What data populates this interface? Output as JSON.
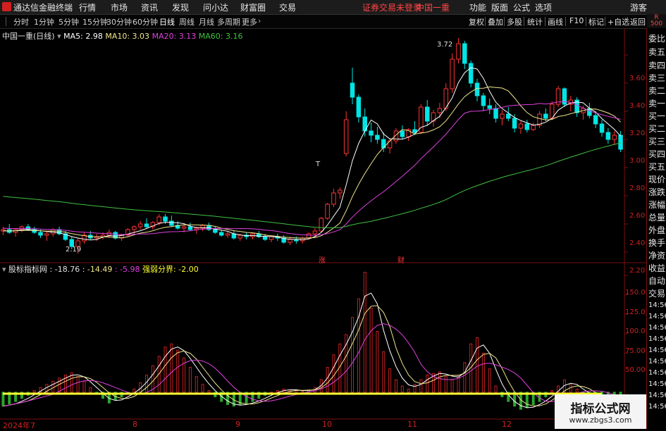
{
  "menubar": {
    "app_title": "通达信金融终端",
    "menus": [
      "行情",
      "市场",
      "资讯",
      "发现",
      "问小达",
      "财富圈",
      "交易"
    ],
    "notice": "证券交易未登录",
    "stock": "中国一重",
    "right_menus": [
      "功能",
      "版面",
      "公式",
      "选项"
    ],
    "user": "游客"
  },
  "periods": [
    "分时",
    "1分钟",
    "5分钟",
    "15分钟",
    "30分钟",
    "60分钟",
    "日线",
    "周线",
    "月线",
    "多周期",
    "更多"
  ],
  "active_period": "日线",
  "toolbar": [
    "复权",
    "叠加",
    "多股",
    "统计",
    "画线",
    "F10",
    "标记",
    "+自选",
    "返回"
  ],
  "corner_badge": {
    "top": "R",
    "bottom": "500"
  },
  "main_legend": {
    "title": "中国一重(日线)",
    "ma5": "MA5: 2.98",
    "ma10": "MA10: 3.03",
    "ma20": "MA20: 3.13",
    "ma60": "MA60: 3.16"
  },
  "sub_legend": {
    "name": "股标指标网",
    "v1": ": -18.76",
    "v2": ": -14.49",
    "v3": ": -5.98",
    "v4": "强弱分界: -2.00"
  },
  "price_axis": [
    "3.60",
    "3.40",
    "3.20",
    "3.00",
    "2.80",
    "2.60",
    "2.40",
    "2.20"
  ],
  "sub_axis": [
    "150.0",
    "125.0",
    "100.0",
    "75.00",
    "50.00"
  ],
  "annotations": {
    "high": "3.72",
    "low": "2.19",
    "t_mark": "T",
    "zhang": "涨",
    "cai": "财"
  },
  "dates": [
    "2024年7",
    "8",
    "9",
    "10",
    "11",
    "12"
  ],
  "side_panel": [
    "委比",
    "卖五",
    "卖四",
    "卖三",
    "卖二",
    "卖一",
    "买一",
    "买二",
    "买三",
    "买四",
    "买五",
    "现价",
    "涨跌",
    "涨幅",
    "总量",
    "外盘",
    "换手",
    "净资",
    "收益",
    "自动",
    "交易",
    "14:56",
    "14:56",
    "14:56",
    "14:56",
    "14:56",
    "14:56",
    "14:56",
    "14:56",
    "14:56",
    "14:56"
  ],
  "watermark": {
    "title": "指标公式网",
    "url": "www.zbgs3.com"
  },
  "colors": {
    "up": "#ff3333",
    "down": "#00e5e5",
    "ma5": "#ffffff",
    "ma10": "#f0e68c",
    "ma20": "#e040e0",
    "ma60": "#40c040",
    "yellow_line": "#ffff33"
  },
  "chart_data": {
    "type": "candlestick",
    "ylim": [
      2.13,
      3.78
    ],
    "candles": [
      [
        2.35,
        2.38,
        2.32,
        2.36
      ],
      [
        2.36,
        2.4,
        2.33,
        2.34
      ],
      [
        2.34,
        2.37,
        2.31,
        2.36
      ],
      [
        2.36,
        2.39,
        2.34,
        2.38
      ],
      [
        2.38,
        2.4,
        2.35,
        2.36
      ],
      [
        2.36,
        2.38,
        2.33,
        2.34
      ],
      [
        2.34,
        2.36,
        2.3,
        2.32
      ],
      [
        2.32,
        2.35,
        2.28,
        2.33
      ],
      [
        2.33,
        2.37,
        2.31,
        2.36
      ],
      [
        2.36,
        2.38,
        2.32,
        2.33
      ],
      [
        2.33,
        2.35,
        2.28,
        2.29
      ],
      [
        2.29,
        2.31,
        2.22,
        2.24
      ],
      [
        2.24,
        2.3,
        2.19,
        2.28
      ],
      [
        2.28,
        2.34,
        2.26,
        2.32
      ],
      [
        2.32,
        2.35,
        2.29,
        2.3
      ],
      [
        2.3,
        2.33,
        2.28,
        2.31
      ],
      [
        2.31,
        2.34,
        2.29,
        2.32
      ],
      [
        2.32,
        2.36,
        2.3,
        2.34
      ],
      [
        2.34,
        2.35,
        2.29,
        2.3
      ],
      [
        2.3,
        2.33,
        2.28,
        2.32
      ],
      [
        2.32,
        2.37,
        2.31,
        2.36
      ],
      [
        2.36,
        2.39,
        2.33,
        2.38
      ],
      [
        2.38,
        2.42,
        2.36,
        2.4
      ],
      [
        2.4,
        2.44,
        2.37,
        2.38
      ],
      [
        2.38,
        2.42,
        2.36,
        2.41
      ],
      [
        2.41,
        2.47,
        2.39,
        2.45
      ],
      [
        2.45,
        2.47,
        2.4,
        2.42
      ],
      [
        2.42,
        2.46,
        2.38,
        2.39
      ],
      [
        2.39,
        2.42,
        2.36,
        2.37
      ],
      [
        2.37,
        2.4,
        2.34,
        2.38
      ],
      [
        2.38,
        2.41,
        2.35,
        2.36
      ],
      [
        2.36,
        2.38,
        2.33,
        2.37
      ],
      [
        2.37,
        2.4,
        2.35,
        2.39
      ],
      [
        2.39,
        2.41,
        2.35,
        2.36
      ],
      [
        2.36,
        2.38,
        2.33,
        2.34
      ],
      [
        2.34,
        2.36,
        2.31,
        2.32
      ],
      [
        2.32,
        2.35,
        2.3,
        2.33
      ],
      [
        2.33,
        2.35,
        2.29,
        2.3
      ],
      [
        2.3,
        2.33,
        2.28,
        2.32
      ],
      [
        2.32,
        2.34,
        2.29,
        2.31
      ],
      [
        2.31,
        2.34,
        2.29,
        2.33
      ],
      [
        2.33,
        2.35,
        2.3,
        2.31
      ],
      [
        2.31,
        2.33,
        2.28,
        2.29
      ],
      [
        2.29,
        2.32,
        2.27,
        2.31
      ],
      [
        2.31,
        2.33,
        2.28,
        2.3
      ],
      [
        2.3,
        2.32,
        2.26,
        2.27
      ],
      [
        2.27,
        2.31,
        2.25,
        2.29
      ],
      [
        2.29,
        2.31,
        2.26,
        2.28
      ],
      [
        2.28,
        2.31,
        2.26,
        2.3
      ],
      [
        2.3,
        2.34,
        2.29,
        2.33
      ],
      [
        2.33,
        2.37,
        2.31,
        2.35
      ],
      [
        2.35,
        2.45,
        2.34,
        2.44
      ],
      [
        2.44,
        2.55,
        2.43,
        2.54
      ],
      [
        2.54,
        2.65,
        2.52,
        2.62
      ],
      [
        2.62,
        2.66,
        2.58,
        2.64
      ],
      [
        2.9,
        3.2,
        2.88,
        3.14
      ],
      [
        3.4,
        3.51,
        3.25,
        3.3
      ],
      [
        3.3,
        3.32,
        3.12,
        3.16
      ],
      [
        3.16,
        3.22,
        3.02,
        3.06
      ],
      [
        3.06,
        3.12,
        2.98,
        3.03
      ],
      [
        3.03,
        3.09,
        2.97,
        3.0
      ],
      [
        3.0,
        3.05,
        2.91,
        2.94
      ],
      [
        2.94,
        3.01,
        2.9,
        2.99
      ],
      [
        2.99,
        3.08,
        2.97,
        3.06
      ],
      [
        3.06,
        3.1,
        3.0,
        3.02
      ],
      [
        3.02,
        3.08,
        2.99,
        3.07
      ],
      [
        3.07,
        3.13,
        3.03,
        3.05
      ],
      [
        3.05,
        3.25,
        3.04,
        3.23
      ],
      [
        3.23,
        3.28,
        3.1,
        3.13
      ],
      [
        3.13,
        3.21,
        3.09,
        3.19
      ],
      [
        3.19,
        3.26,
        3.15,
        3.22
      ],
      [
        3.22,
        3.4,
        3.2,
        3.36
      ],
      [
        3.36,
        3.61,
        3.33,
        3.57
      ],
      [
        3.57,
        3.72,
        3.54,
        3.68
      ],
      [
        3.68,
        3.7,
        3.5,
        3.54
      ],
      [
        3.54,
        3.56,
        3.37,
        3.4
      ],
      [
        3.4,
        3.43,
        3.27,
        3.31
      ],
      [
        3.31,
        3.33,
        3.2,
        3.24
      ],
      [
        3.24,
        3.29,
        3.18,
        3.22
      ],
      [
        3.22,
        3.25,
        3.12,
        3.15
      ],
      [
        3.15,
        3.21,
        3.1,
        3.18
      ],
      [
        3.18,
        3.23,
        3.13,
        3.15
      ],
      [
        3.15,
        3.18,
        3.05,
        3.08
      ],
      [
        3.08,
        3.13,
        3.04,
        3.11
      ],
      [
        3.11,
        3.14,
        3.05,
        3.07
      ],
      [
        3.07,
        3.12,
        3.06,
        3.1
      ],
      [
        3.1,
        3.2,
        3.08,
        3.18
      ],
      [
        3.18,
        3.22,
        3.13,
        3.15
      ],
      [
        3.15,
        3.27,
        3.14,
        3.25
      ],
      [
        3.25,
        3.38,
        3.23,
        3.36
      ],
      [
        3.36,
        3.37,
        3.23,
        3.25
      ],
      [
        3.25,
        3.31,
        3.2,
        3.28
      ],
      [
        3.28,
        3.3,
        3.16,
        3.19
      ],
      [
        3.19,
        3.24,
        3.14,
        3.22
      ],
      [
        3.22,
        3.26,
        3.15,
        3.17
      ],
      [
        3.17,
        3.2,
        3.08,
        3.11
      ],
      [
        3.11,
        3.14,
        3.02,
        3.05
      ],
      [
        3.05,
        3.08,
        2.97,
        3.0
      ],
      [
        3.0,
        3.06,
        2.96,
        3.03
      ],
      [
        3.03,
        3.06,
        2.91,
        2.93
      ]
    ],
    "sub_indicator": {
      "name": "股标指标网",
      "ylim": [
        -30,
        160
      ],
      "threshold": -2,
      "bars": [
        -18,
        -15,
        -12,
        -8,
        -4,
        2,
        6,
        10,
        14,
        18,
        22,
        25,
        20,
        14,
        6,
        -2,
        -8,
        -14,
        -10,
        -6,
        -2,
        4,
        12,
        22,
        34,
        46,
        58,
        62,
        54,
        44,
        32,
        20,
        10,
        2,
        -6,
        -12,
        -16,
        -18,
        -16,
        -14,
        -12,
        -8,
        -4,
        0,
        2,
        4,
        3,
        2,
        1,
        3,
        6,
        16,
        32,
        48,
        62,
        74,
        96,
        120,
        154,
        108,
        78,
        52,
        30,
        16,
        8,
        4,
        10,
        16,
        22,
        24,
        26,
        20,
        16,
        22,
        38,
        62,
        70,
        50,
        30,
        8,
        -6,
        -12,
        -18,
        -22,
        -20,
        -16,
        -12,
        -6,
        2,
        8,
        16,
        10,
        4,
        -2,
        -6,
        -10,
        -12,
        -14,
        -16,
        -18
      ]
    }
  }
}
